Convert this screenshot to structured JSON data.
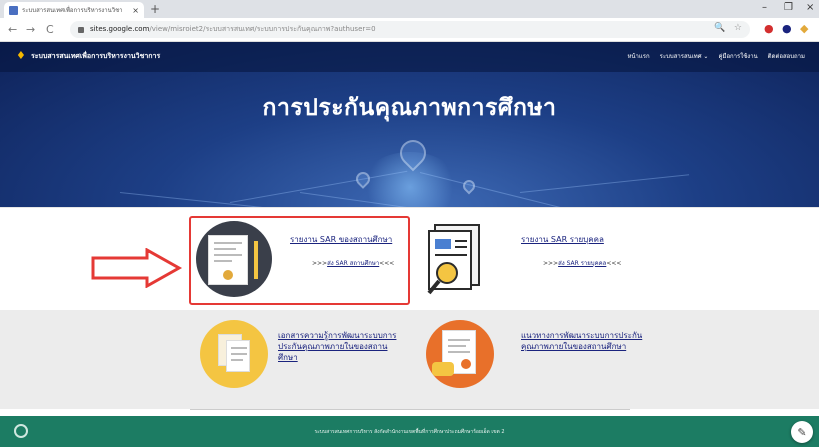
{
  "browser": {
    "tab_title": "ระบบสารสนเทศเพื่อการบริหารงานวิชา",
    "tab_close": "×",
    "new_tab": "+",
    "win_min": "–",
    "win_max": "❐",
    "win_close": "×",
    "back": "←",
    "forward": "→",
    "reload": "C",
    "url_host": "sites.google.com",
    "url_path": "/view/misroiet2/ระบบสารสนเทศ/ระบบการประกันคุณภาพ?authuser=0",
    "zoom_icon": "🔍",
    "star_icon": "☆"
  },
  "site": {
    "logo_glyph": "♦",
    "name": "ระบบสารสนเทศเพื่อการบริหารงานวิชาการ",
    "nav": [
      "หน้าแรก",
      "ระบบสารสนเทศ ⌄",
      "คู่มือการใช้งาน",
      "ติดต่อสอบถาม"
    ],
    "page_title": "การประกันคุณภาพการศึกษา"
  },
  "cards": {
    "sar_school": {
      "title": "รายงาน SAR ของสถานศึกษา",
      "sub_prefix": ">>>",
      "sub_link": "ส่ง SAR สถานศึกษา",
      "sub_suffix": "<<<"
    },
    "sar_person": {
      "title": "รายงาน SAR รายบุคคล",
      "sub_prefix": ">>>",
      "sub_link": "ส่ง SAR รายบุคคล",
      "sub_suffix": "<<<"
    },
    "docs": {
      "title": "เอกสารความรู้การพัฒนาระบบการประกันคุณภาพภายในของสถานศึกษา"
    },
    "guide": {
      "title": "แนวทางการพัฒนาระบบการประกันคุณภาพภายในของสถานศึกษา"
    }
  },
  "footer": {
    "text": "ระบบสารสนเทศการบริหาร สังกัดสำนักงานเขตพื้นที่การศึกษาประถมศึกษาร้อยเอ็ด เขต 2",
    "edit_icon": "✎"
  },
  "colors": {
    "header_dark": "#0e2259",
    "highlight_border": "#e53935",
    "footer": "#1c7c63",
    "link": "#1a237e"
  }
}
